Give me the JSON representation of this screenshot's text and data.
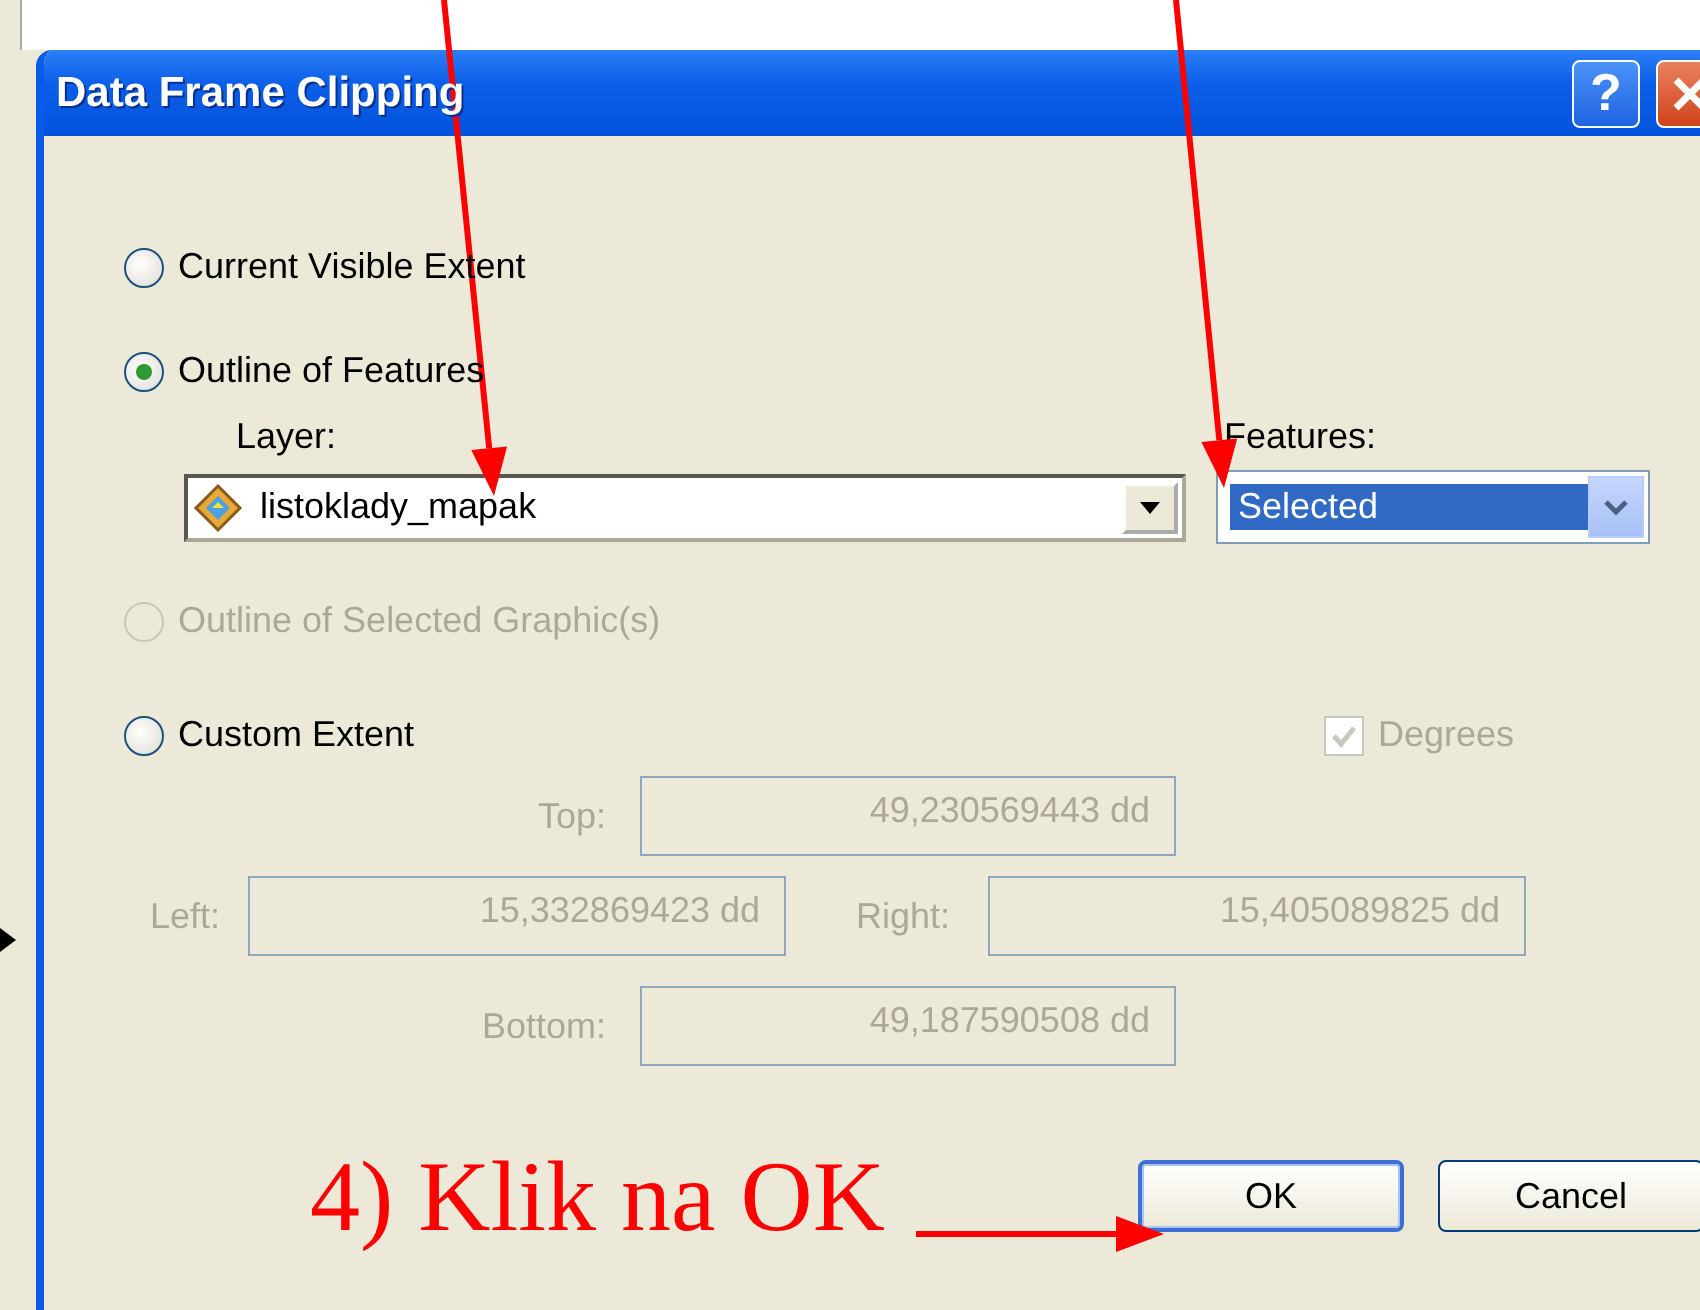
{
  "window": {
    "title": "Data Frame Clipping",
    "controls": [
      {
        "kind": "help",
        "label": "?"
      },
      {
        "kind": "close"
      }
    ]
  },
  "options": [
    {
      "label": "Current Visible Extent",
      "selected": false,
      "disabled": false
    },
    {
      "label": "Outline of Features",
      "selected": true,
      "disabled": false
    },
    {
      "label": "Outline of Selected Graphic(s)",
      "selected": false,
      "disabled": true
    },
    {
      "label": "Custom Extent",
      "selected": false,
      "disabled": false
    }
  ],
  "layer": {
    "label": "Layer:",
    "value": "listoklady_mapak"
  },
  "features": {
    "label": "Features:",
    "value": "Selected",
    "focused": true
  },
  "degrees": {
    "label": "Degrees",
    "checked": true,
    "disabled": true
  },
  "extent": {
    "disabled": true,
    "top": {
      "label": "Top:",
      "value": "49,230569443 dd"
    },
    "left": {
      "label": "Left:",
      "value": "15,332869423 dd"
    },
    "right": {
      "label": "Right:",
      "value": "15,405089825 dd"
    },
    "bottom": {
      "label": "Bottom:",
      "value": "49,187590508 dd"
    }
  },
  "buttons": [
    {
      "label": "OK",
      "default": true
    },
    {
      "label": "Cancel",
      "default": false
    }
  ],
  "annotation": {
    "text": "4) Klik na OK"
  }
}
